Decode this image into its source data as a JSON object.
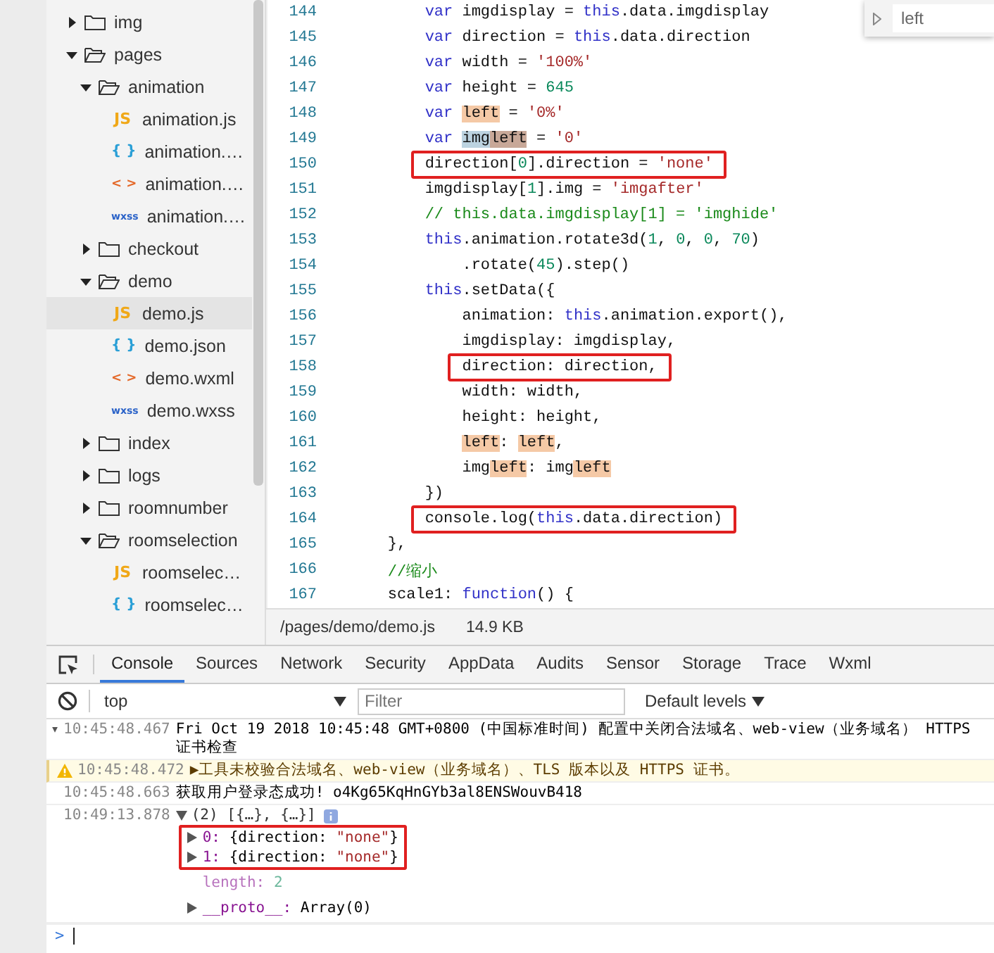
{
  "file_tree": [
    {
      "kind": "folder",
      "name": "img",
      "expanded": false
    },
    {
      "kind": "folder",
      "name": "pages",
      "expanded": true,
      "children": [
        {
          "kind": "folder",
          "name": "animation",
          "expanded": true,
          "children": [
            {
              "kind": "js-file",
              "icon": "JS",
              "name": "animation.js",
              "selected": false
            },
            {
              "kind": "json-file",
              "icon": "{ }",
              "name": "animation.…",
              "selected": false
            },
            {
              "kind": "wxml-file",
              "icon": "< >",
              "name": "animation.…",
              "selected": false
            },
            {
              "kind": "wxss-file",
              "icon": "wxss",
              "name": "animation.…",
              "selected": false
            }
          ]
        },
        {
          "kind": "folder",
          "name": "checkout",
          "expanded": false
        },
        {
          "kind": "folder",
          "name": "demo",
          "expanded": true,
          "children": [
            {
              "kind": "js-file",
              "icon": "JS",
              "name": "demo.js",
              "selected": true
            },
            {
              "kind": "json-file",
              "icon": "{ }",
              "name": "demo.json",
              "selected": false
            },
            {
              "kind": "wxml-file",
              "icon": "< >",
              "name": "demo.wxml",
              "selected": false
            },
            {
              "kind": "wxss-file",
              "icon": "wxss",
              "name": "demo.wxss",
              "selected": false
            }
          ]
        },
        {
          "kind": "folder",
          "name": "index",
          "expanded": false
        },
        {
          "kind": "folder",
          "name": "logs",
          "expanded": false
        },
        {
          "kind": "folder",
          "name": "roomnumber",
          "expanded": false
        },
        {
          "kind": "folder",
          "name": "roomselection",
          "expanded": true,
          "children": [
            {
              "kind": "js-file",
              "icon": "JS",
              "name": "roomselec…",
              "selected": false
            },
            {
              "kind": "json-file",
              "icon": "{ }",
              "name": "roomselec…",
              "selected": false
            }
          ]
        }
      ]
    }
  ],
  "editor": {
    "find_widget": {
      "value": "left"
    },
    "lines": [
      {
        "number": "144",
        "boxed": false,
        "tokens": [
          {
            "text": "        var ",
            "kind": "keyword"
          },
          {
            "text": "imgdisplay = ",
            "kind": "plain"
          },
          {
            "text": "this",
            "kind": "keyword"
          },
          {
            "text": ".data.imgdisplay",
            "kind": "plain"
          }
        ]
      },
      {
        "number": "145",
        "boxed": false,
        "tokens": [
          {
            "text": "        var ",
            "kind": "keyword"
          },
          {
            "text": "direction = ",
            "kind": "plain"
          },
          {
            "text": "this",
            "kind": "keyword"
          },
          {
            "text": ".data.direction",
            "kind": "plain"
          }
        ]
      },
      {
        "number": "146",
        "boxed": false,
        "tokens": [
          {
            "text": "        var ",
            "kind": "keyword"
          },
          {
            "text": "width = ",
            "kind": "plain"
          },
          {
            "text": "'100%'",
            "kind": "string"
          }
        ]
      },
      {
        "number": "147",
        "boxed": false,
        "tokens": [
          {
            "text": "        var ",
            "kind": "keyword"
          },
          {
            "text": "height = ",
            "kind": "plain"
          },
          {
            "text": "645",
            "kind": "number"
          }
        ]
      },
      {
        "number": "148",
        "boxed": false,
        "tokens": [
          {
            "text": "        var ",
            "kind": "keyword"
          },
          {
            "text": "left",
            "kind": "match"
          },
          {
            "text": " = ",
            "kind": "plain"
          },
          {
            "text": "'0%'",
            "kind": "string"
          }
        ]
      },
      {
        "number": "149",
        "boxed": false,
        "tokens": [
          {
            "text": "        var ",
            "kind": "keyword"
          },
          {
            "text": "img",
            "kind": "selection"
          },
          {
            "text": "left",
            "kind": "current"
          },
          {
            "text": " = ",
            "kind": "plain"
          },
          {
            "text": "'0'",
            "kind": "string"
          }
        ]
      },
      {
        "number": "150",
        "boxed": true,
        "tokens": [
          {
            "text": "        direction[",
            "kind": "plain"
          },
          {
            "text": "0",
            "kind": "number"
          },
          {
            "text": "].direction = ",
            "kind": "plain"
          },
          {
            "text": "'none'",
            "kind": "string"
          }
        ]
      },
      {
        "number": "151",
        "boxed": false,
        "tokens": [
          {
            "text": "        imgdisplay[",
            "kind": "plain"
          },
          {
            "text": "1",
            "kind": "number"
          },
          {
            "text": "].img = ",
            "kind": "plain"
          },
          {
            "text": "'imgafter'",
            "kind": "string"
          }
        ]
      },
      {
        "number": "152",
        "boxed": false,
        "tokens": [
          {
            "text": "        // this.data.imgdisplay[1] = 'imghide'",
            "kind": "comment"
          }
        ]
      },
      {
        "number": "153",
        "boxed": false,
        "tokens": [
          {
            "text": "        this",
            "kind": "keyword"
          },
          {
            "text": ".animation.rotate3d(",
            "kind": "plain"
          },
          {
            "text": "1",
            "kind": "number"
          },
          {
            "text": ", ",
            "kind": "plain"
          },
          {
            "text": "0",
            "kind": "number"
          },
          {
            "text": ", ",
            "kind": "plain"
          },
          {
            "text": "0",
            "kind": "number"
          },
          {
            "text": ", ",
            "kind": "plain"
          },
          {
            "text": "70",
            "kind": "number"
          },
          {
            "text": ")",
            "kind": "plain"
          }
        ]
      },
      {
        "number": "154",
        "boxed": false,
        "tokens": [
          {
            "text": "            .rotate(",
            "kind": "plain"
          },
          {
            "text": "45",
            "kind": "number"
          },
          {
            "text": ").step()",
            "kind": "plain"
          }
        ]
      },
      {
        "number": "155",
        "boxed": false,
        "tokens": [
          {
            "text": "        this",
            "kind": "keyword"
          },
          {
            "text": ".setData({",
            "kind": "plain"
          }
        ]
      },
      {
        "number": "156",
        "boxed": false,
        "tokens": [
          {
            "text": "            animation: ",
            "kind": "plain"
          },
          {
            "text": "this",
            "kind": "keyword"
          },
          {
            "text": ".animation.export(),",
            "kind": "plain"
          }
        ]
      },
      {
        "number": "157",
        "boxed": false,
        "tokens": [
          {
            "text": "            imgdisplay: imgdisplay,",
            "kind": "plain"
          }
        ]
      },
      {
        "number": "158",
        "boxed": true,
        "tokens": [
          {
            "text": "            direction: direction,",
            "kind": "plain"
          }
        ]
      },
      {
        "number": "159",
        "boxed": false,
        "tokens": [
          {
            "text": "            width: width,",
            "kind": "plain"
          }
        ]
      },
      {
        "number": "160",
        "boxed": false,
        "tokens": [
          {
            "text": "            height: height,",
            "kind": "plain"
          }
        ]
      },
      {
        "number": "161",
        "boxed": false,
        "tokens": [
          {
            "text": "            left",
            "kind": "match"
          },
          {
            "text": ": ",
            "kind": "plain"
          },
          {
            "text": "left",
            "kind": "match"
          },
          {
            "text": ",",
            "kind": "plain"
          }
        ]
      },
      {
        "number": "162",
        "boxed": false,
        "tokens": [
          {
            "text": "            img",
            "kind": "plain"
          },
          {
            "text": "left",
            "kind": "match"
          },
          {
            "text": ": img",
            "kind": "plain"
          },
          {
            "text": "left",
            "kind": "match"
          }
        ]
      },
      {
        "number": "163",
        "boxed": false,
        "tokens": [
          {
            "text": "        })",
            "kind": "plain"
          }
        ]
      },
      {
        "number": "164",
        "boxed": true,
        "tokens": [
          {
            "text": "        console.log(",
            "kind": "plain"
          },
          {
            "text": "this",
            "kind": "keyword"
          },
          {
            "text": ".data.direction)",
            "kind": "plain"
          }
        ]
      },
      {
        "number": "165",
        "boxed": false,
        "tokens": [
          {
            "text": "    },",
            "kind": "plain"
          }
        ]
      },
      {
        "number": "166",
        "boxed": false,
        "tokens": [
          {
            "text": "    //缩小",
            "kind": "comment"
          }
        ]
      },
      {
        "number": "167",
        "boxed": false,
        "tokens": [
          {
            "text": "    scale1: ",
            "kind": "plain"
          },
          {
            "text": "function",
            "kind": "keyword"
          },
          {
            "text": "() {",
            "kind": "plain"
          }
        ]
      }
    ],
    "status_bar": {
      "path": "/pages/demo/demo.js",
      "size": "14.9 KB"
    }
  },
  "devtools": {
    "tabs": [
      {
        "label": "Console",
        "selected": true
      },
      {
        "label": "Sources",
        "selected": false
      },
      {
        "label": "Network",
        "selected": false
      },
      {
        "label": "Security",
        "selected": false
      },
      {
        "label": "AppData",
        "selected": false
      },
      {
        "label": "Audits",
        "selected": false
      },
      {
        "label": "Sensor",
        "selected": false
      },
      {
        "label": "Storage",
        "selected": false
      },
      {
        "label": "Trace",
        "selected": false
      },
      {
        "label": "Wxml",
        "selected": false
      }
    ],
    "context": "top",
    "filter": {
      "placeholder": "Filter"
    },
    "levels": "Default levels",
    "messages": [
      {
        "kind": "log",
        "expander": "▾",
        "time": "10:45:48.467",
        "text": "Fri Oct 19 2018 10:45:48 GMT+0800 (中国标准时间) 配置中关闭合法域名、web-view（业务域名） HTTPS 证书检查"
      },
      {
        "kind": "warning",
        "time": "10:45:48.472",
        "text": "▶工具未校验合法域名、web-view（业务域名）、TLS 版本以及 HTTPS 证书。"
      },
      {
        "kind": "log",
        "time": "10:45:48.663",
        "text": "获取用户登录态成功! o4Kg65KqHnGYb3al8ENSWouvB418"
      },
      {
        "kind": "object",
        "time": "10:49:13.878",
        "expanded": true,
        "summary": "(2) [{…}, {…}]",
        "properties": [
          {
            "key": "0:",
            "expandable": true,
            "boxed": true,
            "dim": false,
            "tokens": [
              {
                "text": "{direction: ",
                "kind": "plain"
              },
              {
                "text": "\"none\"",
                "kind": "string"
              },
              {
                "text": "}",
                "kind": "plain"
              }
            ]
          },
          {
            "key": "1:",
            "expandable": true,
            "boxed": true,
            "dim": false,
            "tokens": [
              {
                "text": "{direction: ",
                "kind": "plain"
              },
              {
                "text": "\"none\"",
                "kind": "string"
              },
              {
                "text": "}",
                "kind": "plain"
              }
            ]
          },
          {
            "key": "length:",
            "expandable": false,
            "boxed": false,
            "dim": true,
            "tokens": [
              {
                "text": "2",
                "kind": "number"
              }
            ]
          },
          {
            "key": "__proto__:",
            "expandable": true,
            "boxed": false,
            "dim": false,
            "tokens": [
              {
                "text": "Array(0)",
                "kind": "plain"
              }
            ]
          }
        ]
      }
    ],
    "prompt": ">"
  }
}
